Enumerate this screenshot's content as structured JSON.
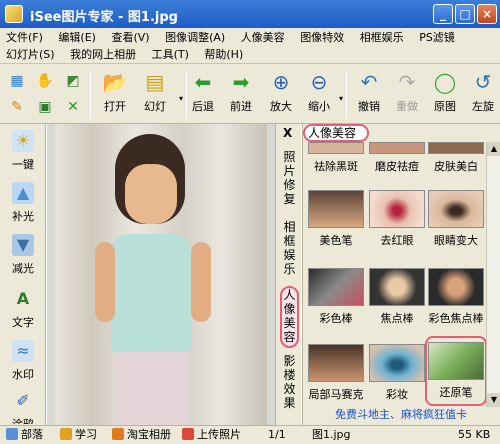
{
  "window": {
    "title": "iSee图片专家 - 图1.jpg",
    "buttons": {
      "minimize": "_",
      "maximize": "□",
      "close": "×"
    }
  },
  "menu": {
    "row1": [
      "文件(F)",
      "编辑(E)",
      "查看(V)",
      "图像调整(A)",
      "人像美容",
      "图像特效",
      "相框娱乐",
      "PS滤镜"
    ],
    "row2": [
      "幻灯片(S)",
      "我的网上相册",
      "工具(T)",
      "帮助(H)"
    ]
  },
  "toolbar": {
    "buttons": [
      {
        "label": "打开",
        "icon": "open-folder-icon"
      },
      {
        "label": "幻灯",
        "icon": "slideshow-icon"
      },
      {
        "label": "后退",
        "icon": "back-arrow-icon"
      },
      {
        "label": "前进",
        "icon": "forward-arrow-icon"
      },
      {
        "label": "放大",
        "icon": "zoom-in-icon"
      },
      {
        "label": "缩小",
        "icon": "zoom-out-icon"
      },
      {
        "label": "撤销",
        "icon": "undo-icon"
      },
      {
        "label": "重做",
        "icon": "redo-icon"
      },
      {
        "label": "原图",
        "icon": "original-icon"
      },
      {
        "label": "左旋",
        "icon": "rotate-left-icon"
      }
    ]
  },
  "sidebar": {
    "items": [
      {
        "label": "一键",
        "icon": "one-click-icon"
      },
      {
        "label": "补光",
        "icon": "fill-light-icon"
      },
      {
        "label": "减光",
        "icon": "reduce-light-icon"
      },
      {
        "label": "文字",
        "icon": "text-icon"
      },
      {
        "label": "水印",
        "icon": "watermark-icon"
      },
      {
        "label": "涂鸦",
        "icon": "doodle-icon"
      }
    ]
  },
  "vtabs": {
    "close": "X",
    "tabs": [
      {
        "label": "照片修复",
        "active": false
      },
      {
        "label": "相框娱乐",
        "active": false
      },
      {
        "label": "人像美容",
        "active": true
      },
      {
        "label": "影楼效果",
        "active": false
      }
    ]
  },
  "panel": {
    "title": "人像美容",
    "items": [
      {
        "label": "祛除黑斑"
      },
      {
        "label": "磨皮祛痘"
      },
      {
        "label": "皮肤美白"
      },
      {
        "label": "美色笔"
      },
      {
        "label": "去红眼"
      },
      {
        "label": "眼睛变大"
      },
      {
        "label": "彩色棒"
      },
      {
        "label": "焦点棒"
      },
      {
        "label": "彩色焦点棒"
      },
      {
        "label": "局部马赛克"
      },
      {
        "label": "彩妆"
      },
      {
        "label": "还原笔",
        "selected": true
      }
    ],
    "promo": "免费斗地主、麻将疯狂值卡"
  },
  "statusbar": {
    "items": [
      "部落",
      "学习",
      "淘宝相册",
      "上传照片",
      "1/1",
      "图1.jpg",
      "55 KB"
    ]
  },
  "colors": {
    "accent_highlight": "#e06074",
    "titlebar": "#2b6ad0",
    "chrome": "#ece9d8",
    "promo_text": "#1e50c8"
  }
}
